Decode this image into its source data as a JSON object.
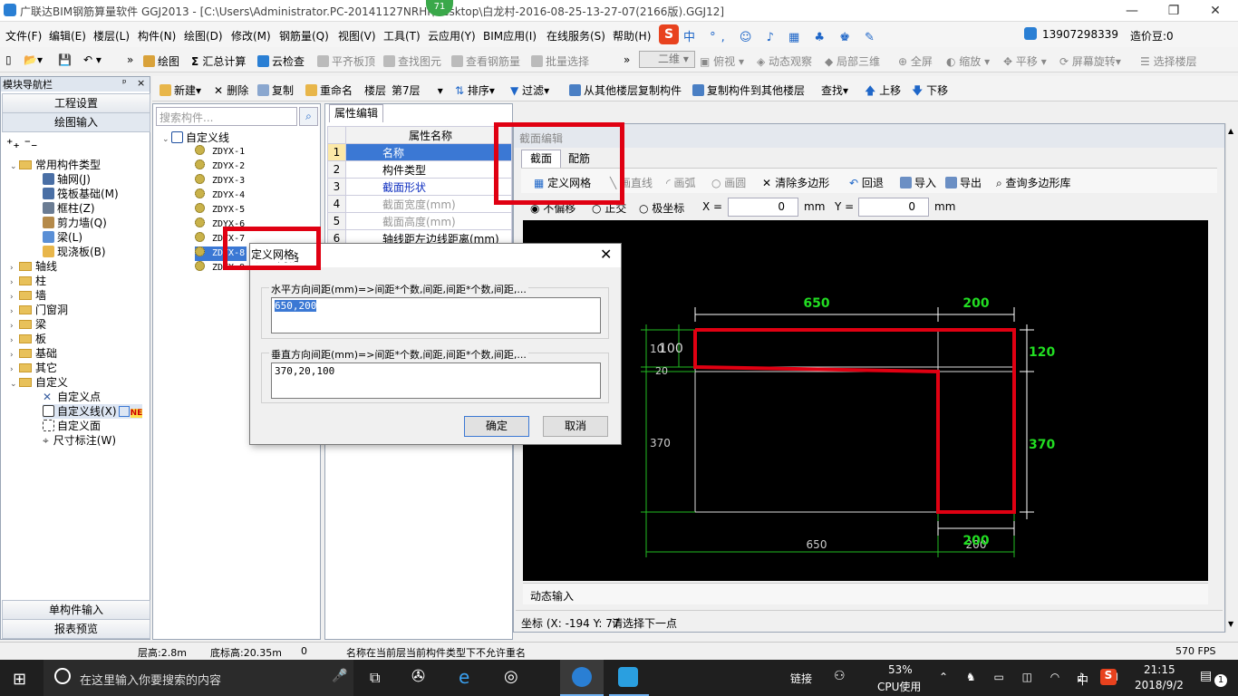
{
  "window": {
    "title": "广联达BIM钢筋算量软件 GGJ2013 - [C:\\Users\\Administrator.PC-20141127NRHI\\Desktop\\白龙村-2016-08-25-13-27-07(2166版).GGJ12]",
    "badge": "71"
  },
  "menu": [
    "文件(F)",
    "编辑(E)",
    "楼层(L)",
    "构件(N)",
    "绘图(D)",
    "修改(M)",
    "钢筋量(Q)",
    "视图(V)",
    "工具(T)",
    "云应用(Y)",
    "BIM应用(I)",
    "在线服务(S)",
    "帮助(H)"
  ],
  "account": {
    "phone": "13907298339",
    "beans": "造价豆:0"
  },
  "toolbar1": {
    "draw": "绘图",
    "sum": "汇总计算",
    "cloud_check": "云检查",
    "flat_slab": "平齐板顶",
    "find_elem": "查找图元",
    "view_rebar": "查看钢筋量",
    "batch_select": "批量选择",
    "view_mode": "二维",
    "top_view": "俯视",
    "dynamic_view": "动态观察",
    "local_3d": "局部三维",
    "fullscreen": "全屏",
    "zoom": "缩放",
    "pan": "平移",
    "rotate": "屏幕旋转",
    "select_floor": "选择楼层"
  },
  "toolbar2": {
    "new": "新建",
    "delete": "删除",
    "copy": "复制",
    "rename": "重命名",
    "floor_label": "楼层",
    "floor_value": "第7层",
    "sort": "排序",
    "filter": "过滤",
    "copy_from": "从其他楼层复制构件",
    "copy_to": "复制构件到其他楼层",
    "find": "查找",
    "up": "上移",
    "down": "下移"
  },
  "nav": {
    "title": "模块导航栏",
    "project_settings": "工程设置",
    "drawing_input": "绘图输入",
    "single_input": "单构件输入",
    "report_preview": "报表预览",
    "tree": [
      {
        "label": "常用构件类型",
        "children": [
          "轴网(J)",
          "筏板基础(M)",
          "框柱(Z)",
          "剪力墙(Q)",
          "梁(L)",
          "现浇板(B)"
        ]
      },
      {
        "label": "轴线"
      },
      {
        "label": "柱"
      },
      {
        "label": "墙"
      },
      {
        "label": "门窗洞"
      },
      {
        "label": "梁"
      },
      {
        "label": "板"
      },
      {
        "label": "基础"
      },
      {
        "label": "其它"
      },
      {
        "label": "自定义",
        "children": [
          "自定义点",
          "自定义线(X)",
          "自定义面",
          "尺寸标注(W)"
        ]
      }
    ],
    "new_badge": "NE"
  },
  "list": {
    "search_placeholder": "搜索构件...",
    "root": "自定义线",
    "items": [
      "ZDYX-1",
      "ZDYX-2",
      "ZDYX-3",
      "ZDYX-4",
      "ZDYX-5",
      "ZDYX-6",
      "ZDYX-7",
      "ZDYX-8",
      "ZDYX-9"
    ]
  },
  "props": {
    "tab": "属性编辑",
    "header": "属性名称",
    "rows": [
      {
        "num": "1",
        "name": "名称"
      },
      {
        "num": "2",
        "name": "构件类型"
      },
      {
        "num": "3",
        "name": "截面形状"
      },
      {
        "num": "4",
        "name": "截面宽度(mm)"
      },
      {
        "num": "5",
        "name": "截面高度(mm)"
      },
      {
        "num": "6",
        "name": "轴线距左边线距离(mm)"
      }
    ]
  },
  "section_editor": {
    "title": "截面编辑",
    "tabs": [
      "截面",
      "配筋"
    ],
    "tools": {
      "define_grid": "定义网格",
      "line": "画直线",
      "arc": "画弧",
      "circle": "画圆",
      "clear": "清除多边形",
      "undo": "回退",
      "import": "导入",
      "export": "导出",
      "query": "查询多边形库"
    },
    "mode": {
      "no_offset": "不偏移",
      "orthogonal": "正交",
      "polar": "极坐标",
      "x_label": "X =",
      "x_value": "0",
      "y_label": "Y =",
      "y_value": "0",
      "unit": "mm"
    },
    "dims": {
      "top_left": "650",
      "top_right": "200",
      "bottom_left": "650",
      "bottom_right": "200",
      "bottom_right_green": "200",
      "left_100": "100",
      "left_10": "10",
      "left_20": "20",
      "left_370": "370",
      "right_120": "120",
      "right_370": "370"
    },
    "dynamic_input": "动态输入",
    "coord_label": "坐标 (X: -194 Y: 77",
    "coord_hint": "请选择下一点"
  },
  "dialog": {
    "title": "定义网格",
    "h_label": "水平方向间距(mm)=>间距*个数,间距,间距*个数,间距,...",
    "h_value": "650,200",
    "v_label": "垂直方向间距(mm)=>间距*个数,间距,间距*个数,间距,...",
    "v_value": "370,20,100",
    "ok": "确定",
    "cancel": "取消"
  },
  "status": {
    "floor_height": "层高:2.8m",
    "bottom_height": "底标高:20.35m",
    "zero": "0",
    "message": "名称在当前层当前构件类型下不允许重名",
    "fps": "570 FPS"
  },
  "taskbar": {
    "search": "在这里输入你要搜索的内容",
    "link": "链接",
    "cpu_pct": "53%",
    "cpu_label": "CPU使用",
    "ime": "中",
    "time": "21:15",
    "date": "2018/9/2",
    "notif": "1"
  },
  "colors": {
    "accent_red": "#e00012",
    "canvas": "#000000",
    "dim_green": "#22cc22",
    "selected": "#3b78d4"
  }
}
